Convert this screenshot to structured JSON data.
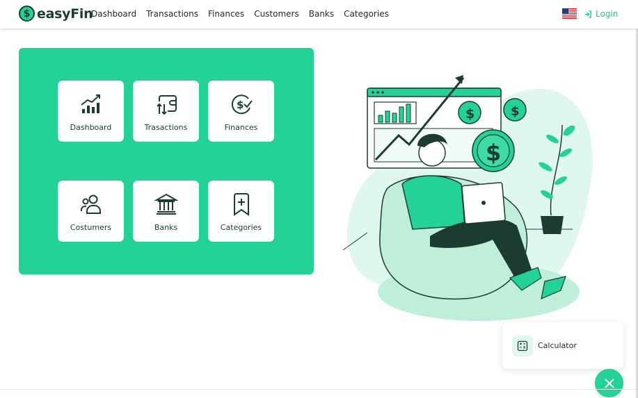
{
  "brand": {
    "logo_glyph": "$",
    "name": "easyFin"
  },
  "nav": {
    "links": [
      "Dashboard",
      "Transactions",
      "Finances",
      "Customers",
      "Banks",
      "Categories"
    ],
    "flag_icon": "us-flag-icon",
    "login_label": "Login"
  },
  "tiles": [
    {
      "label": "Dashboard",
      "icon": "bar-chart-up-icon"
    },
    {
      "label": "Trasactions",
      "icon": "wallet-arrows-icon"
    },
    {
      "label": "Finances",
      "icon": "dollar-check-icon"
    },
    {
      "label": "Costumers",
      "icon": "users-icon"
    },
    {
      "label": "Banks",
      "icon": "bank-icon"
    },
    {
      "label": "Categories",
      "icon": "bookmark-plus-icon"
    }
  ],
  "calculator": {
    "label": "Calculator",
    "icon": "calculator-icon"
  },
  "colors": {
    "accent": "#24d196",
    "dark": "#1b3b33",
    "login": "#24c98e"
  }
}
